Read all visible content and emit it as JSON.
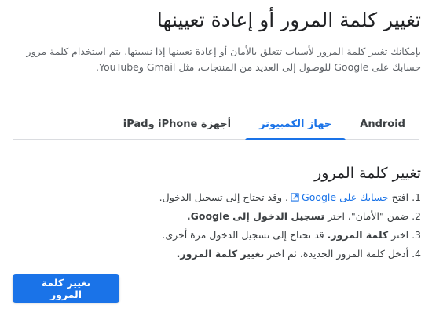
{
  "page": {
    "title": "تغيير كلمة المرور أو إعادة تعيينها",
    "intro_line1": "بإمكانك تغيير كلمة المرور لأسباب تتعلق بالأمان أو إعادة تعيينها إذا نسيتها. يتم استخدام كلمة مرور",
    "intro_line2": "حسابك على Google للوصول إلى العديد من المنتجات، مثل Gmail وYouTube."
  },
  "tabs": [
    {
      "label": "Android",
      "active": false
    },
    {
      "label": "جهاز الكمبيوتر",
      "active": true
    },
    {
      "label": "أجهزة iPhone وiPad",
      "active": false
    }
  ],
  "section": {
    "title": "تغيير كلمة المرور",
    "steps": {
      "s1_num": "1.",
      "s1_pre": "افتح",
      "s1_link": "حسابك على Google",
      "s1_post": ". وقد تحتاج إلى تسجيل الدخول.",
      "s2_num": "2.",
      "s2_pre": "ضمن \"الأمان\"، اختر",
      "s2_bold": "تسجيل الدخول إلى Google.",
      "s3_num": "3.",
      "s3_pre": "اختر",
      "s3_bold": "كلمة المرور.",
      "s3_post": "قد تحتاج إلى تسجيل الدخول مرة أخرى.",
      "s4_num": "4.",
      "s4_pre": "أدخل كلمة المرور الجديدة، ثم اختر",
      "s4_bold": "تغيير كلمة المرور."
    },
    "button_label": "تغيير كلمة المرور"
  },
  "icons": {
    "external_link": "external-link-icon"
  },
  "colors": {
    "accent": "#1a73e8",
    "text": "#202124",
    "muted": "#5f6368"
  }
}
